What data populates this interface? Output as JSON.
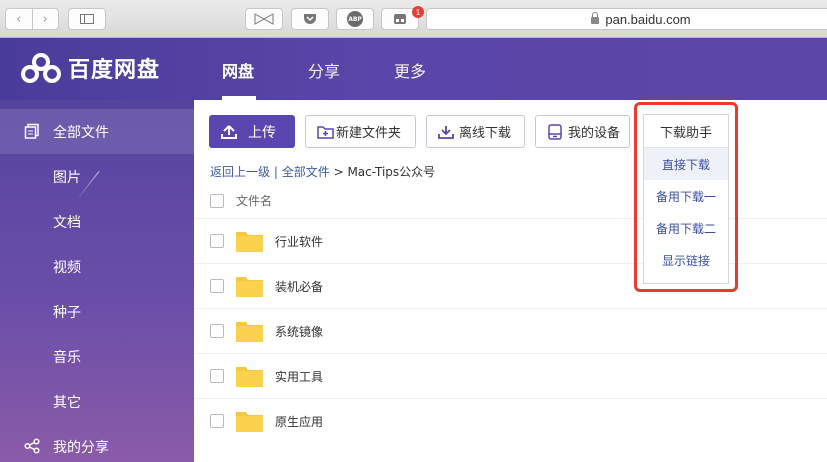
{
  "browser": {
    "url": "pan.baidu.com",
    "extension_badge": "1",
    "abp_label": "ABP"
  },
  "header": {
    "brand": "百度网盘",
    "nav": [
      "网盘",
      "分享",
      "更多"
    ]
  },
  "sidebar": {
    "items": [
      {
        "label": "全部文件",
        "icon": "files-icon"
      },
      {
        "label": "图片"
      },
      {
        "label": "文档"
      },
      {
        "label": "视频"
      },
      {
        "label": "种子"
      },
      {
        "label": "音乐"
      },
      {
        "label": "其它"
      },
      {
        "label": "我的分享",
        "icon": "share-icon"
      }
    ]
  },
  "toolbar": {
    "upload": "上传",
    "new_folder": "新建文件夹",
    "offline_download": "离线下载",
    "my_devices": "我的设备"
  },
  "breadcrumb": {
    "back": "返回上一级",
    "sep": "|",
    "all_files": "全部文件",
    "arrow": ">",
    "current": "Mac-Tips公众号"
  },
  "list": {
    "column_name": "文件名",
    "files": [
      {
        "name": "行业软件"
      },
      {
        "name": "装机必备"
      },
      {
        "name": "系统镜像"
      },
      {
        "name": "实用工具"
      },
      {
        "name": "原生应用"
      }
    ]
  },
  "download_helper": {
    "title": "下载助手",
    "options": [
      "直接下载",
      "备用下载一",
      "备用下载二",
      "显示链接"
    ]
  },
  "colors": {
    "header": "#5a46a8",
    "primary_button": "#5a46b0",
    "highlight": "#e43d2f",
    "folder": "#f5c842"
  }
}
